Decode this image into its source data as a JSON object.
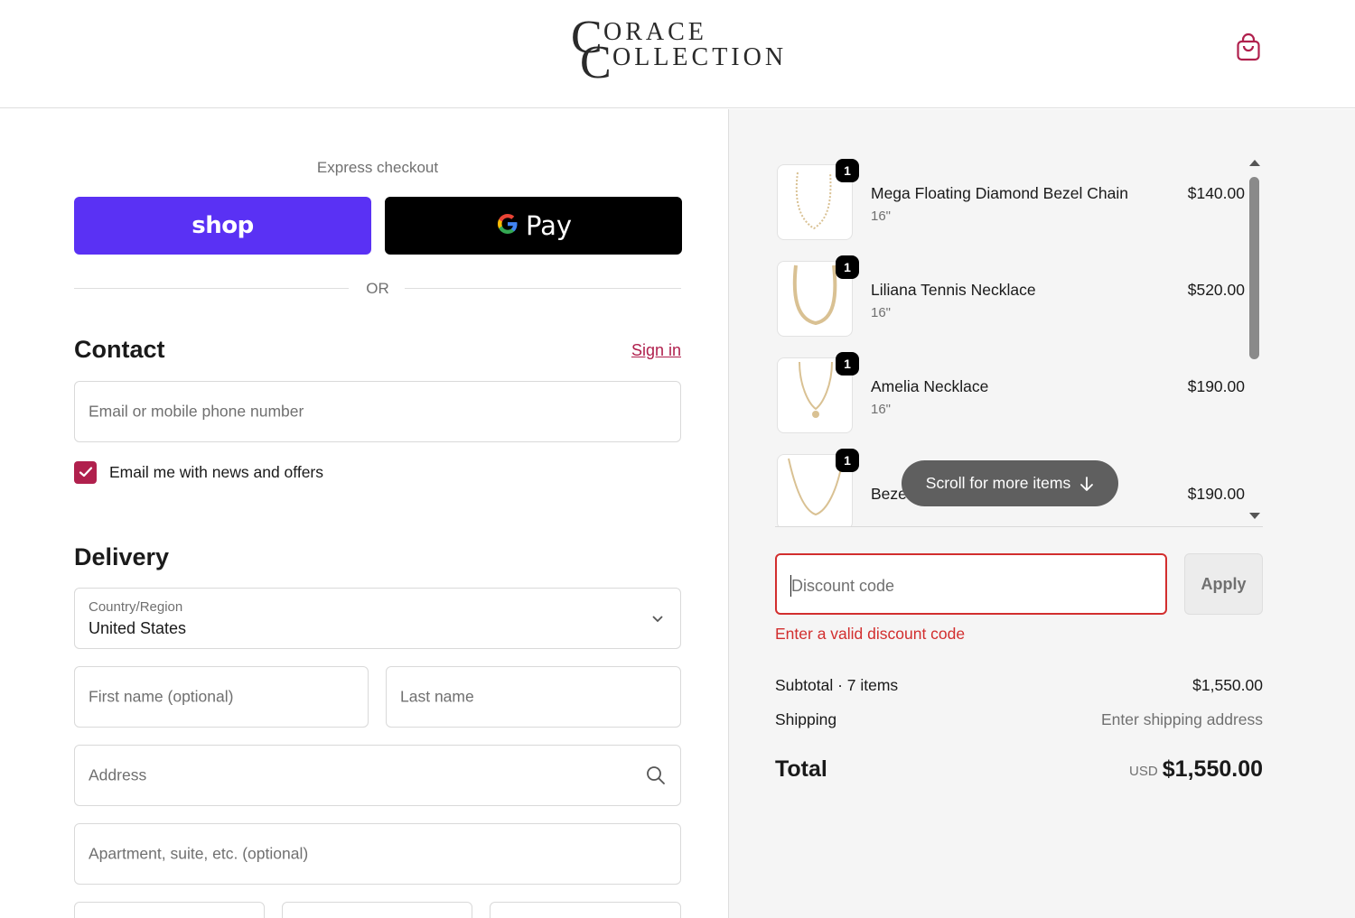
{
  "brand": {
    "logo_initial_1": "C",
    "logo_line_1": "ORACE",
    "logo_initial_2": "C",
    "logo_line_2": "OLLECTION"
  },
  "header": {
    "cart_icon": "shopping-bag-icon"
  },
  "express": {
    "title": "Express checkout",
    "shop_label": "shop",
    "gpay_label": "Pay",
    "or_label": "OR"
  },
  "contact": {
    "title": "Contact",
    "sign_in": "Sign in",
    "email_placeholder": "Email or mobile phone number",
    "newsletter_label": "Email me with news and offers",
    "newsletter_checked": true
  },
  "delivery": {
    "title": "Delivery",
    "country_label": "Country/Region",
    "country_value": "United States",
    "first_name_placeholder": "First name (optional)",
    "last_name_placeholder": "Last name",
    "address_placeholder": "Address",
    "apartment_placeholder": "Apartment, suite, etc. (optional)"
  },
  "order": {
    "items": [
      {
        "qty": "1",
        "name": "Mega Floating Diamond Bezel Chain",
        "variant": "16\"",
        "price": "$140.00"
      },
      {
        "qty": "1",
        "name": "Liliana Tennis Necklace",
        "variant": "16\"",
        "price": "$520.00"
      },
      {
        "qty": "1",
        "name": "Amelia Necklace",
        "variant": "16\"",
        "price": "$190.00"
      },
      {
        "qty": "1",
        "name": "Beze",
        "variant": "",
        "price": "$190.00"
      }
    ],
    "scroll_hint": "Scroll for more items",
    "discount_placeholder": "Discount code",
    "apply_label": "Apply",
    "discount_error": "Enter a valid discount code",
    "subtotal_label": "Subtotal · 7 items",
    "subtotal_value": "$1,550.00",
    "shipping_label": "Shipping",
    "shipping_value": "Enter shipping address",
    "total_label": "Total",
    "total_currency": "USD",
    "total_value": "$1,550.00"
  },
  "colors": {
    "accent": "#b0204d",
    "shop_purple": "#5a31f4",
    "error": "#d22e2e",
    "summary_bg": "#f5f5f5"
  }
}
